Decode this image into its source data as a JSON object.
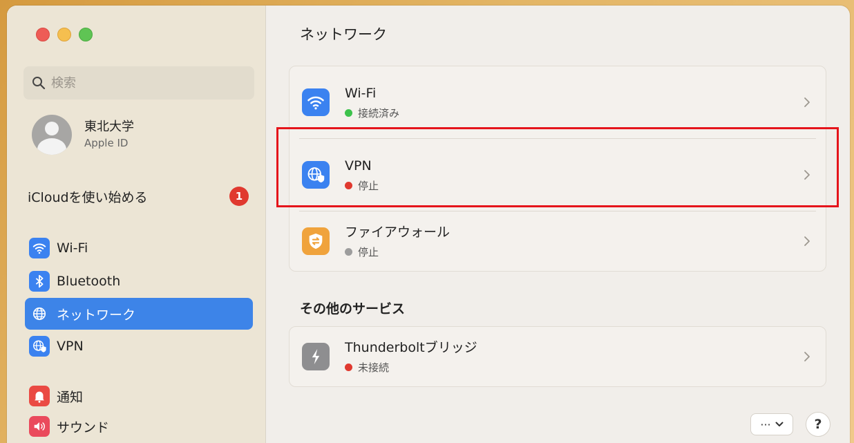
{
  "window": {
    "title": "ネットワーク"
  },
  "sidebar": {
    "search": {
      "placeholder": "検索",
      "value": ""
    },
    "account": {
      "name": "東北大学",
      "subtitle": "Apple ID"
    },
    "icloud": {
      "label": "iCloudを使い始める",
      "badge": "1"
    },
    "items": [
      {
        "label": "Wi-Fi",
        "icon": "wifi-icon",
        "active": false
      },
      {
        "label": "Bluetooth",
        "icon": "bluetooth-icon",
        "active": false
      },
      {
        "label": "ネットワーク",
        "icon": "network-globe-icon",
        "active": true
      },
      {
        "label": "VPN",
        "icon": "vpn-icon",
        "active": false
      },
      {
        "label": "通知",
        "icon": "notification-bell-icon",
        "active": false
      },
      {
        "label": "サウンド",
        "icon": "speaker-icon",
        "active": false
      }
    ]
  },
  "main": {
    "title": "ネットワーク",
    "services": [
      {
        "title": "Wi-Fi",
        "status": "接続済み",
        "status_color": "#3dc24c",
        "icon": "wifi-icon"
      },
      {
        "title": "VPN",
        "status": "停止",
        "status_color": "#e0392f",
        "icon": "vpn-icon"
      },
      {
        "title": "ファイアウォール",
        "status": "停止",
        "status_color": "#9d9d9d",
        "icon": "firewall-icon"
      }
    ],
    "other_section_title": "その他のサービス",
    "other_services": [
      {
        "title": "Thunderboltブリッジ",
        "status": "未接続",
        "status_color": "#e0392f",
        "icon": "thunderbolt-icon"
      }
    ],
    "more_button": "···",
    "help_button": "?"
  },
  "colors": {
    "accent": "#3d84e8",
    "highlight": "#e5141b"
  }
}
